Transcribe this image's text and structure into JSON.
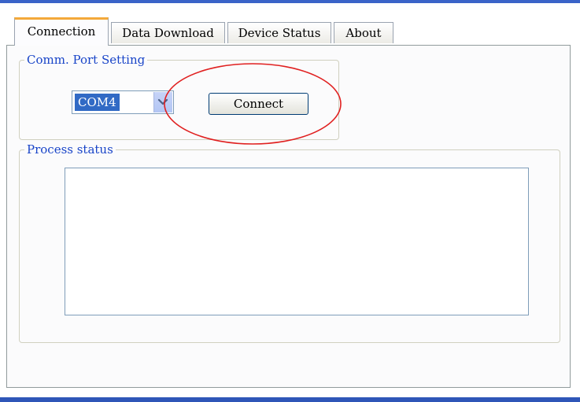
{
  "tabs": [
    {
      "label": "Connection",
      "active": true
    },
    {
      "label": "Data Download",
      "active": false
    },
    {
      "label": "Device Status",
      "active": false
    },
    {
      "label": "About",
      "active": false
    }
  ],
  "comm_port": {
    "legend": "Comm. Port Setting",
    "selected_port": "COM4",
    "connect_label": "Connect"
  },
  "process_status": {
    "legend": "Process status",
    "text": ""
  },
  "colors": {
    "legend_text": "#1844c8",
    "active_tab_accent": "#f4a93a",
    "selection": "#316ac5",
    "highlight_circle": "#e02020"
  },
  "icons": {
    "combo_arrow": "chevron-down-icon"
  }
}
